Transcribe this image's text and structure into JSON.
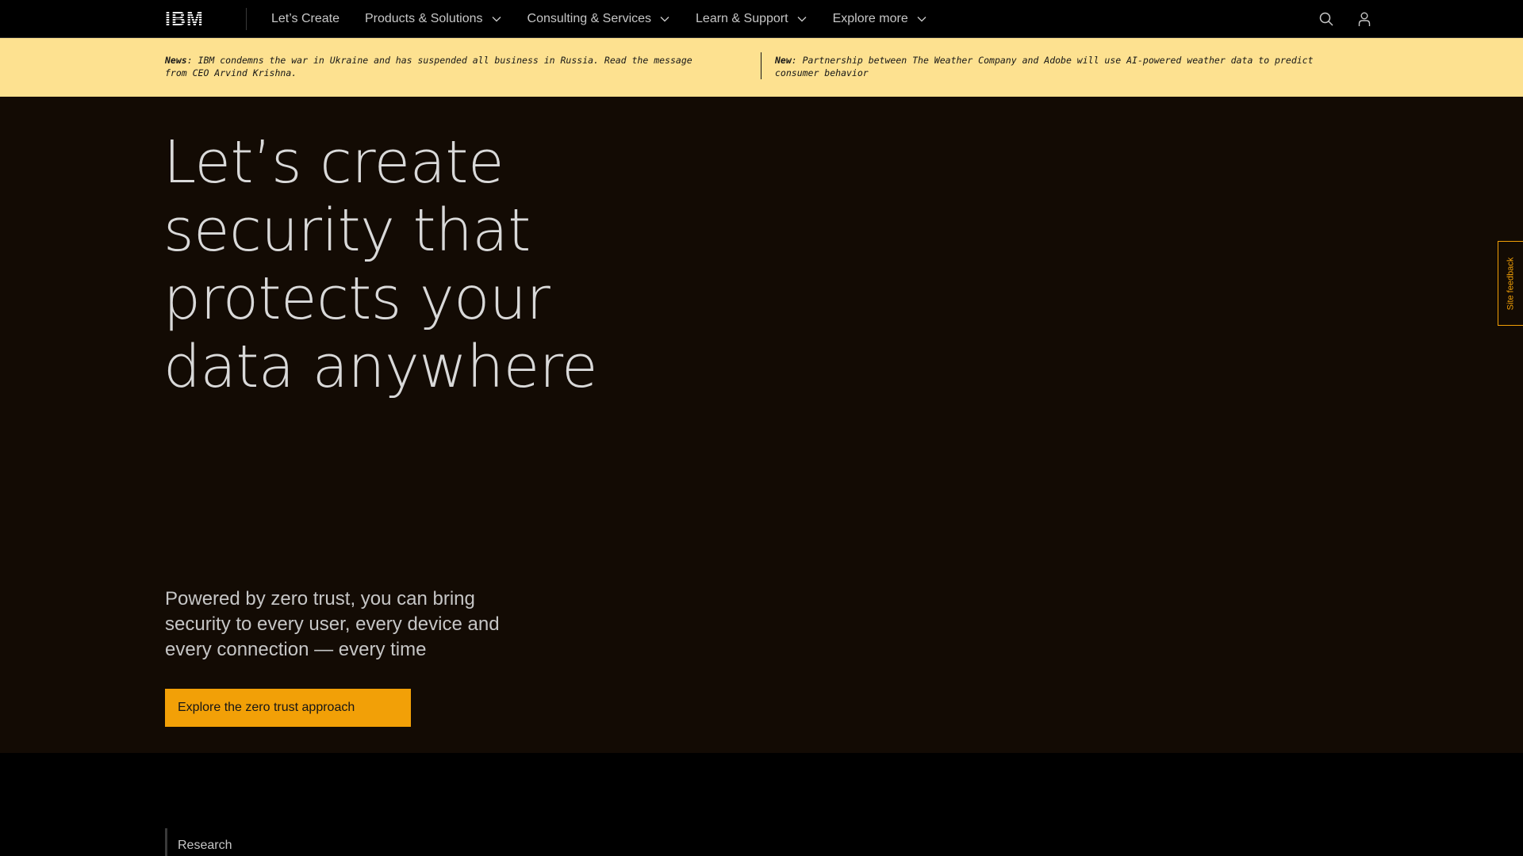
{
  "nav": {
    "logo": "IBM",
    "items": [
      {
        "label": "Let’s Create",
        "has_menu": false
      },
      {
        "label": "Products & Solutions",
        "has_menu": true
      },
      {
        "label": "Consulting & Services",
        "has_menu": true
      },
      {
        "label": "Learn & Support",
        "has_menu": true
      },
      {
        "label": "Explore more",
        "has_menu": true
      }
    ],
    "icons": [
      "search-icon",
      "user-icon"
    ]
  },
  "banner": {
    "news_1_prefix": "News",
    "news_1_text": ": IBM condemns the war in Ukraine and has suspended all business in Russia. Read the message from CEO Arvind Krishna.",
    "news_2_prefix": "New",
    "news_2_text": ": Partnership between The Weather Company and Adobe will use AI-powered weather data to predict consumer behavior"
  },
  "hero": {
    "title": "Let’s create security that protects your data anywhere",
    "subtitle": "Powered by zero trust, you can bring security to every user, every device and every connection — every time",
    "cta_label": "Explore the zero trust approach"
  },
  "feedback": {
    "label": "Site feedback"
  },
  "next_section": {
    "label": "Research"
  },
  "colors": {
    "accent": "#f2a007",
    "banner_bg": "#fde190",
    "hero_bg": "#130b04",
    "nav_bg": "#000000"
  }
}
